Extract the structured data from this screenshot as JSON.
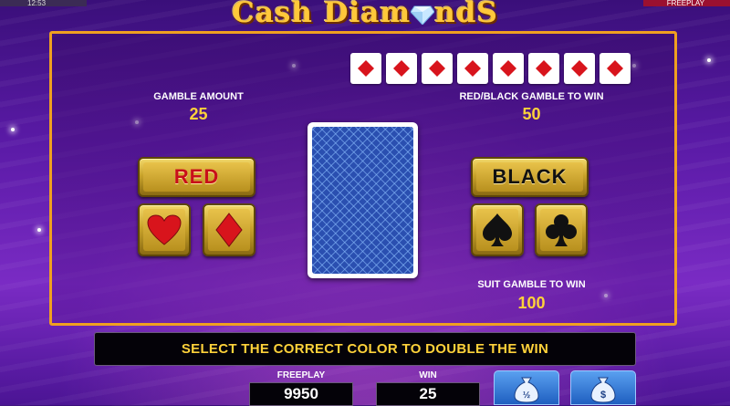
{
  "status": {
    "time": "12:53",
    "mode": "FREEPLAY"
  },
  "logo": {
    "text_left": "Cash Diam",
    "text_right": "ndS"
  },
  "history": {
    "cards": [
      "diamond",
      "diamond",
      "diamond",
      "diamond",
      "diamond",
      "diamond",
      "diamond",
      "diamond"
    ],
    "color": "#d8141c"
  },
  "gamble_amount": {
    "label": "GAMBLE AMOUNT",
    "value": "25"
  },
  "red_black": {
    "label": "RED/BLACK GAMBLE TO WIN",
    "value": "50"
  },
  "suit_gamble": {
    "label": "SUIT GAMBLE TO WIN",
    "value": "100"
  },
  "buttons": {
    "red": {
      "label": "RED",
      "color": "#c8101a"
    },
    "black": {
      "label": "BLACK",
      "color": "#111111"
    },
    "suits": [
      "heart-icon",
      "diamond-icon",
      "spade-icon",
      "club-icon"
    ]
  },
  "message": "SELECT THE CORRECT COLOR TO DOUBLE THE WIN",
  "meters": {
    "freeplay": {
      "label": "FREEPLAY",
      "value": "9950"
    },
    "win": {
      "label": "WIN",
      "value": "25"
    }
  },
  "colors": {
    "accent_gold": "#ffd23a",
    "frame": "#f0a020"
  }
}
